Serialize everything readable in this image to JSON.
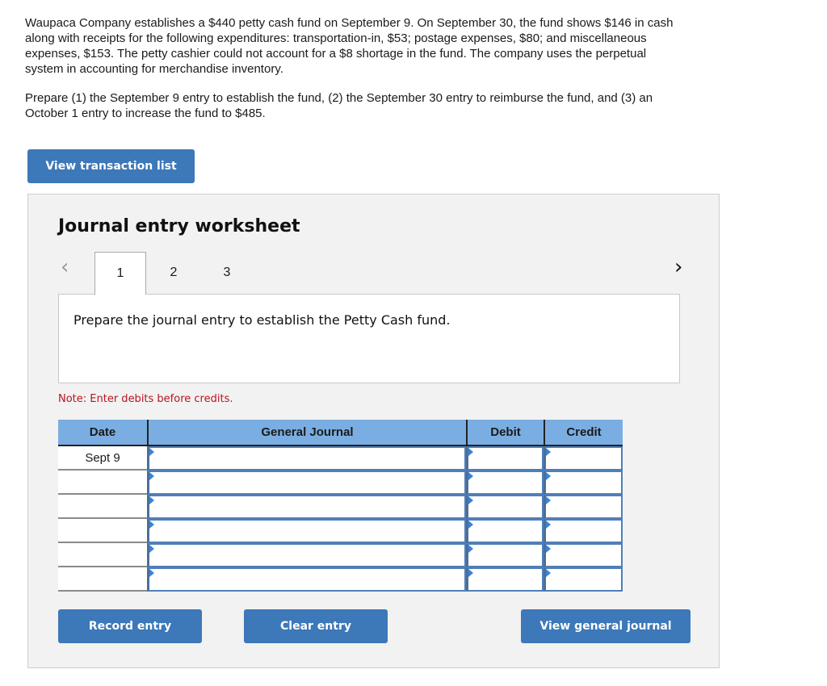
{
  "problem": {
    "paragraphs": [
      "Waupaca Company establishes a $440 petty cash fund on September 9. On September 30, the fund shows $146 in cash along with receipts for the following expenditures: transportation-in, $53; postage expenses, $80; and miscellaneous expenses, $153. The petty cashier could not account for a $8 shortage in the fund. The company uses the perpetual system in accounting for merchandise inventory.",
      "Prepare (1) the September 9 entry to establish the fund, (2) the September 30 entry to reimburse the fund, and (3) an October 1 entry to increase the fund to $485."
    ]
  },
  "buttons": {
    "view_transaction_list": "View transaction list",
    "record_entry": "Record entry",
    "clear_entry": "Clear entry",
    "view_general_journal": "View general journal"
  },
  "worksheet": {
    "title": "Journal entry worksheet",
    "nav_prev_icon": "‹",
    "nav_next_icon": "›",
    "tabs": [
      {
        "label": "1",
        "active": true
      },
      {
        "label": "2",
        "active": false
      },
      {
        "label": "3",
        "active": false
      }
    ],
    "instruction": "Prepare the journal entry to establish the Petty Cash fund.",
    "note": "Note: Enter debits before credits."
  },
  "journal": {
    "headers": {
      "date": "Date",
      "account": "General Journal",
      "debit": "Debit",
      "credit": "Credit"
    },
    "rows": [
      {
        "date": "Sept 9",
        "account": "",
        "debit": "",
        "credit": ""
      },
      {
        "date": "",
        "account": "",
        "debit": "",
        "credit": ""
      },
      {
        "date": "",
        "account": "",
        "debit": "",
        "credit": ""
      },
      {
        "date": "",
        "account": "",
        "debit": "",
        "credit": ""
      },
      {
        "date": "",
        "account": "",
        "debit": "",
        "credit": ""
      },
      {
        "date": "",
        "account": "",
        "debit": "",
        "credit": ""
      }
    ]
  },
  "colors": {
    "button_blue": "#3d78b8",
    "header_blue": "#7aaee2",
    "note_red": "#b8141f"
  }
}
